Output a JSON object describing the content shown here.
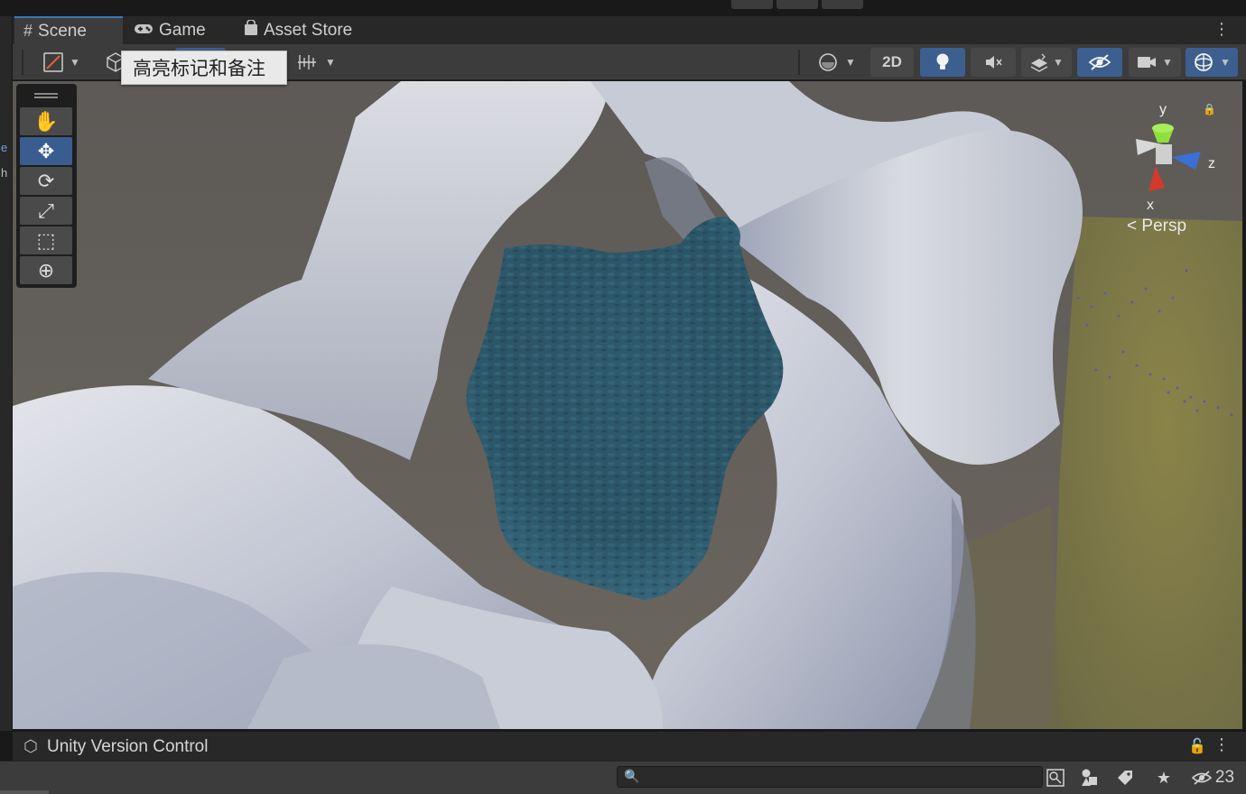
{
  "tabs": [
    {
      "label": "Scene",
      "icon": "grid-hash-icon"
    },
    {
      "label": "Game",
      "icon": "gamepad-icon"
    },
    {
      "label": "Asset Store",
      "icon": "shopping-bag-icon"
    }
  ],
  "toolbar": {
    "tooltip": "高亮标记和备注",
    "toggle_2d": "2D"
  },
  "tools": [
    "hand-tool",
    "move-tool",
    "rotate-tool",
    "scale-tool",
    "rect-tool",
    "transform-tool"
  ],
  "active_tool": "move-tool",
  "gizmo": {
    "y": "y",
    "x": "x",
    "z": "z",
    "projection": "Persp"
  },
  "status_panel": {
    "title": "Unity Version Control"
  },
  "project_bar": {
    "search_value": "",
    "hidden_count": "23"
  },
  "left_strip_fragments": [
    "e",
    "h"
  ],
  "colors": {
    "accent": "#3a79bb",
    "active_button": "#3d5f8f",
    "water": "#2e5d70",
    "axis_x": "#d33a2c",
    "axis_y": "#8fe03b",
    "axis_z": "#3a6fd8"
  }
}
